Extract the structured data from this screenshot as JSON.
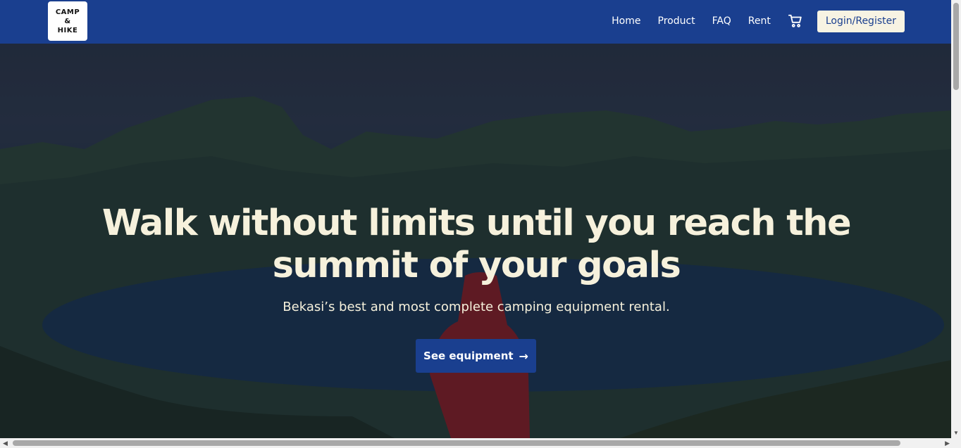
{
  "logo": {
    "line1": "CAMP",
    "line2": "&",
    "line3": "HIKE"
  },
  "nav": {
    "links": [
      "Home",
      "Product",
      "FAQ",
      "Rent"
    ],
    "cart_icon": "cart-icon",
    "login_label": "Login/Register"
  },
  "hero": {
    "title": "Walk without limits until you reach the summit of your goals",
    "subtitle": "Bekasi’s best and most complete camping equipment rental.",
    "cta_label": "See equipment",
    "cta_icon": "arrow-right-icon"
  },
  "colors": {
    "nav_bg": "#1a3f8f",
    "hero_text": "#f6f1dc",
    "login_bg": "#f7f3e3",
    "cta_bg": "#1a3f8f"
  }
}
